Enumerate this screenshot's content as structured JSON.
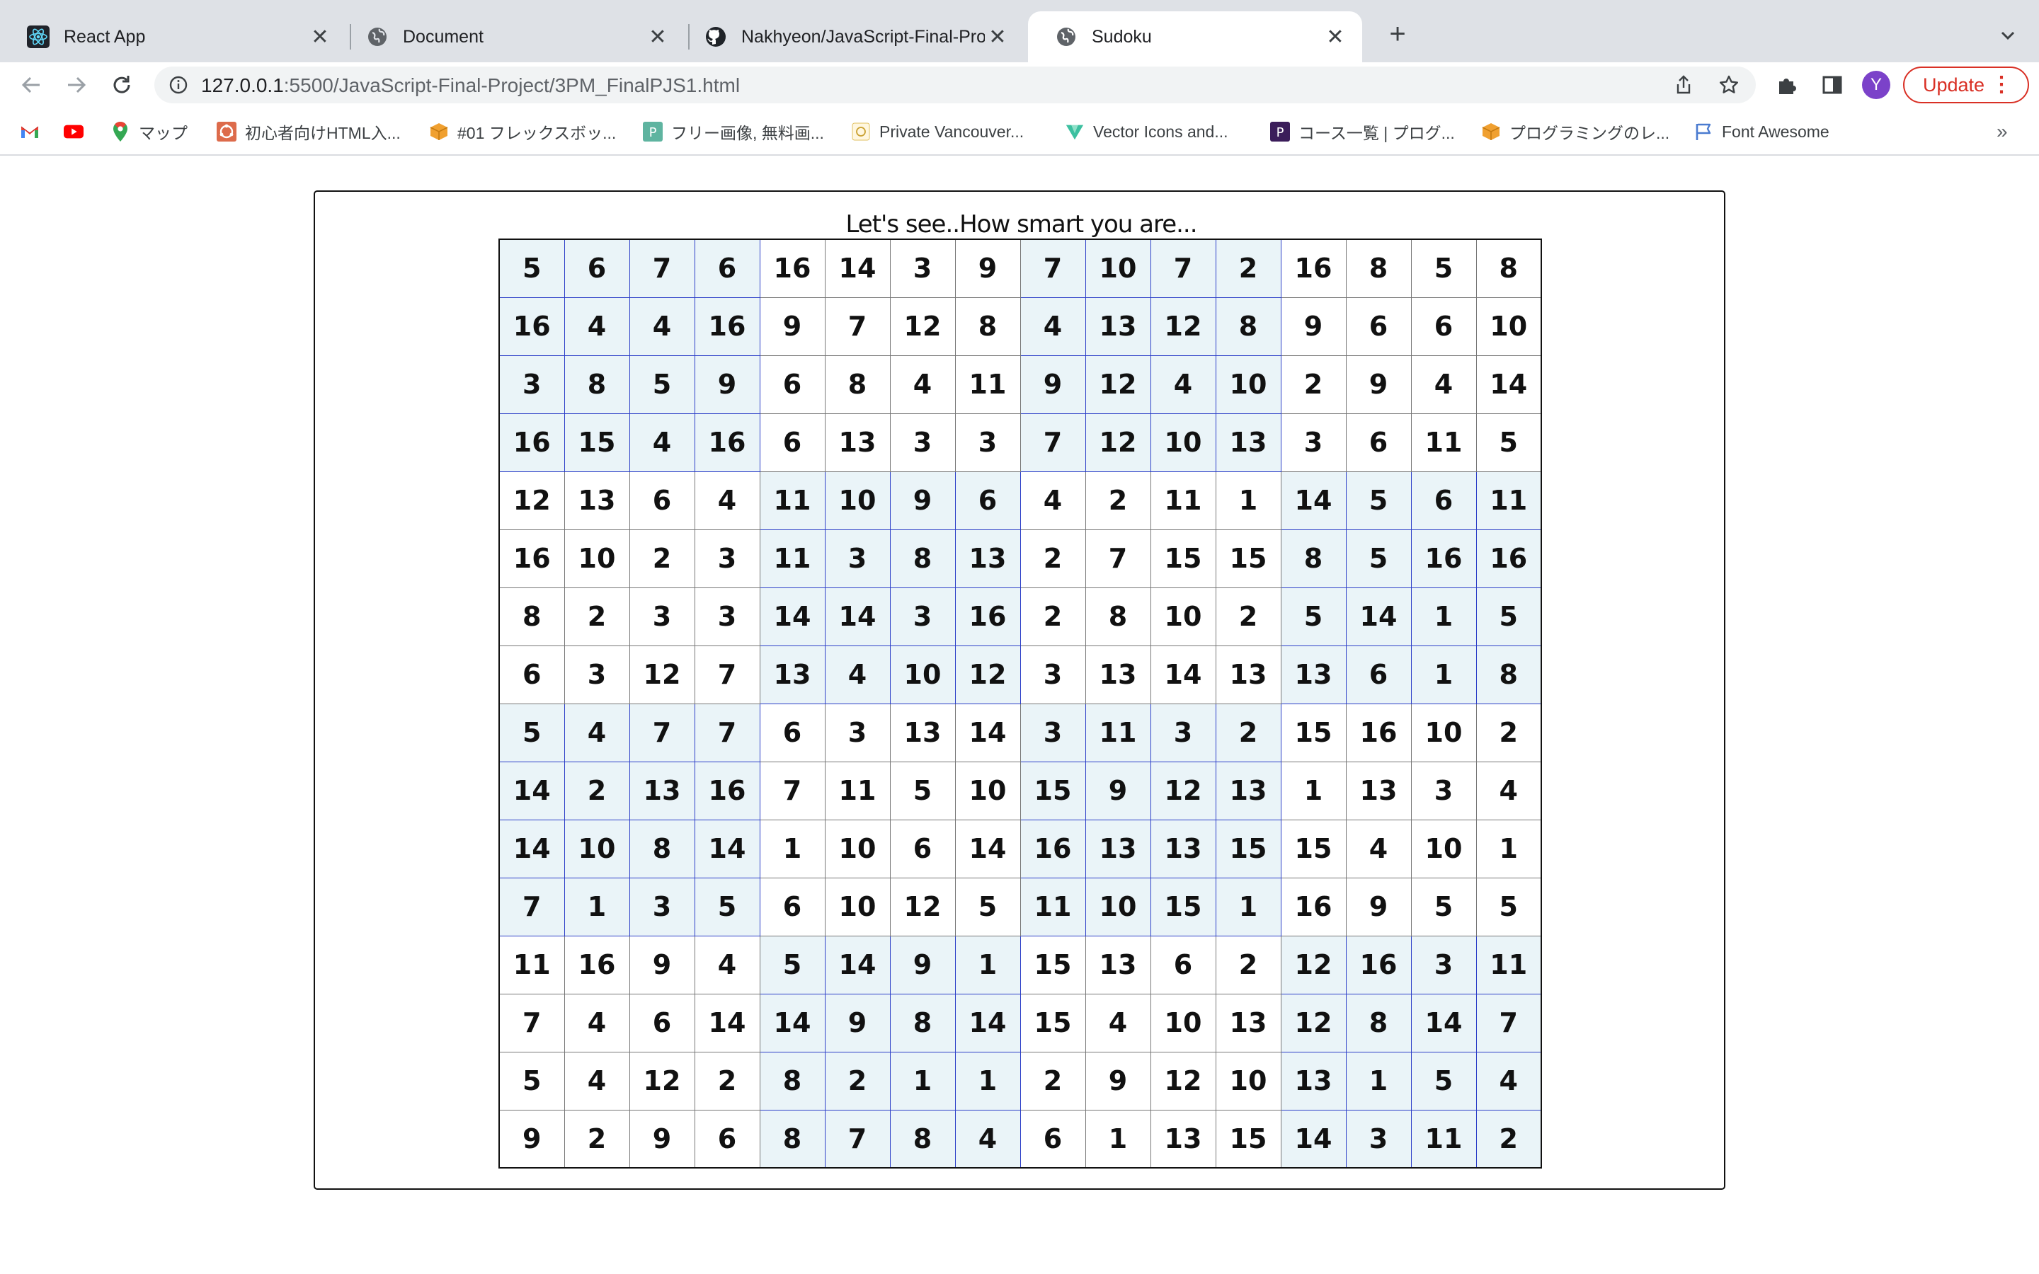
{
  "browser": {
    "tabs": [
      {
        "title": "React App",
        "icon": "react-icon",
        "active": false
      },
      {
        "title": "Document",
        "icon": "globe-icon",
        "active": false
      },
      {
        "title": "Nakhyeon/JavaScript-Final-Pro",
        "icon": "github-icon",
        "active": false
      },
      {
        "title": "Sudoku",
        "icon": "globe-icon",
        "active": true
      }
    ],
    "new_tab_label": "+",
    "url_host": "127.0.0.1",
    "url_path": ":5500/JavaScript-Final-Project/3PM_FinalPJS1.html",
    "avatar_initial": "Y",
    "update_label": "Update",
    "update_menu_glyph": "⋮",
    "bookmarks_more": "»",
    "bookmarks": [
      {
        "label": "",
        "icon": "gmail-icon"
      },
      {
        "label": "",
        "icon": "youtube-icon"
      },
      {
        "label": "マップ",
        "icon": "maps-icon"
      },
      {
        "label": "初心者向けHTML入...",
        "icon": "ubuntu-icon"
      },
      {
        "label": "#01 フレックスボッ...",
        "icon": "box-icon"
      },
      {
        "label": "フリー画像, 無料画...",
        "icon": "image-icon"
      },
      {
        "label": "Private Vancouver...",
        "icon": "circle-icon"
      },
      {
        "label": "Vector Icons and...",
        "icon": "vector-icon"
      },
      {
        "label": "コース一覧 | プログ...",
        "icon": "p-icon"
      },
      {
        "label": "プログラミングのレ...",
        "icon": "box-icon"
      },
      {
        "label": "Font Awesome",
        "icon": "flag-icon"
      }
    ],
    "accent": "#d93025"
  },
  "page": {
    "heading": "Let's see..How smart you are...",
    "shade_color": "#eaf4f8",
    "box_border_color": "#2d3fc8",
    "grid": [
      [
        5,
        6,
        7,
        6,
        16,
        14,
        3,
        9,
        7,
        10,
        7,
        2,
        16,
        8,
        5,
        8
      ],
      [
        16,
        4,
        4,
        16,
        9,
        7,
        12,
        8,
        4,
        13,
        12,
        8,
        9,
        6,
        6,
        10
      ],
      [
        3,
        8,
        5,
        9,
        6,
        8,
        4,
        11,
        9,
        12,
        4,
        10,
        2,
        9,
        4,
        14
      ],
      [
        16,
        15,
        4,
        16,
        6,
        13,
        3,
        3,
        7,
        12,
        10,
        13,
        3,
        6,
        11,
        5
      ],
      [
        12,
        13,
        6,
        4,
        11,
        10,
        9,
        6,
        4,
        2,
        11,
        1,
        14,
        5,
        6,
        11
      ],
      [
        16,
        10,
        2,
        3,
        11,
        3,
        8,
        13,
        2,
        7,
        15,
        15,
        8,
        5,
        16,
        16
      ],
      [
        8,
        2,
        3,
        3,
        14,
        14,
        3,
        16,
        2,
        8,
        10,
        2,
        5,
        14,
        1,
        5
      ],
      [
        6,
        3,
        12,
        7,
        13,
        4,
        10,
        12,
        3,
        13,
        14,
        13,
        13,
        6,
        1,
        8
      ],
      [
        5,
        4,
        7,
        7,
        6,
        3,
        13,
        14,
        3,
        11,
        3,
        2,
        15,
        16,
        10,
        2
      ],
      [
        14,
        2,
        13,
        16,
        7,
        11,
        5,
        10,
        15,
        9,
        12,
        13,
        1,
        13,
        3,
        4
      ],
      [
        14,
        10,
        8,
        14,
        1,
        10,
        6,
        14,
        16,
        13,
        13,
        15,
        15,
        4,
        10,
        1
      ],
      [
        7,
        1,
        3,
        5,
        6,
        10,
        12,
        5,
        11,
        10,
        15,
        1,
        16,
        9,
        5,
        5
      ],
      [
        11,
        16,
        9,
        4,
        5,
        14,
        9,
        1,
        15,
        13,
        6,
        2,
        12,
        16,
        3,
        11
      ],
      [
        7,
        4,
        6,
        14,
        14,
        9,
        8,
        14,
        15,
        4,
        10,
        13,
        12,
        8,
        14,
        7
      ],
      [
        5,
        4,
        12,
        2,
        8,
        2,
        1,
        1,
        2,
        9,
        12,
        10,
        13,
        1,
        5,
        4
      ],
      [
        9,
        2,
        9,
        6,
        8,
        7,
        8,
        4,
        6,
        1,
        13,
        15,
        14,
        3,
        11,
        2
      ]
    ]
  }
}
